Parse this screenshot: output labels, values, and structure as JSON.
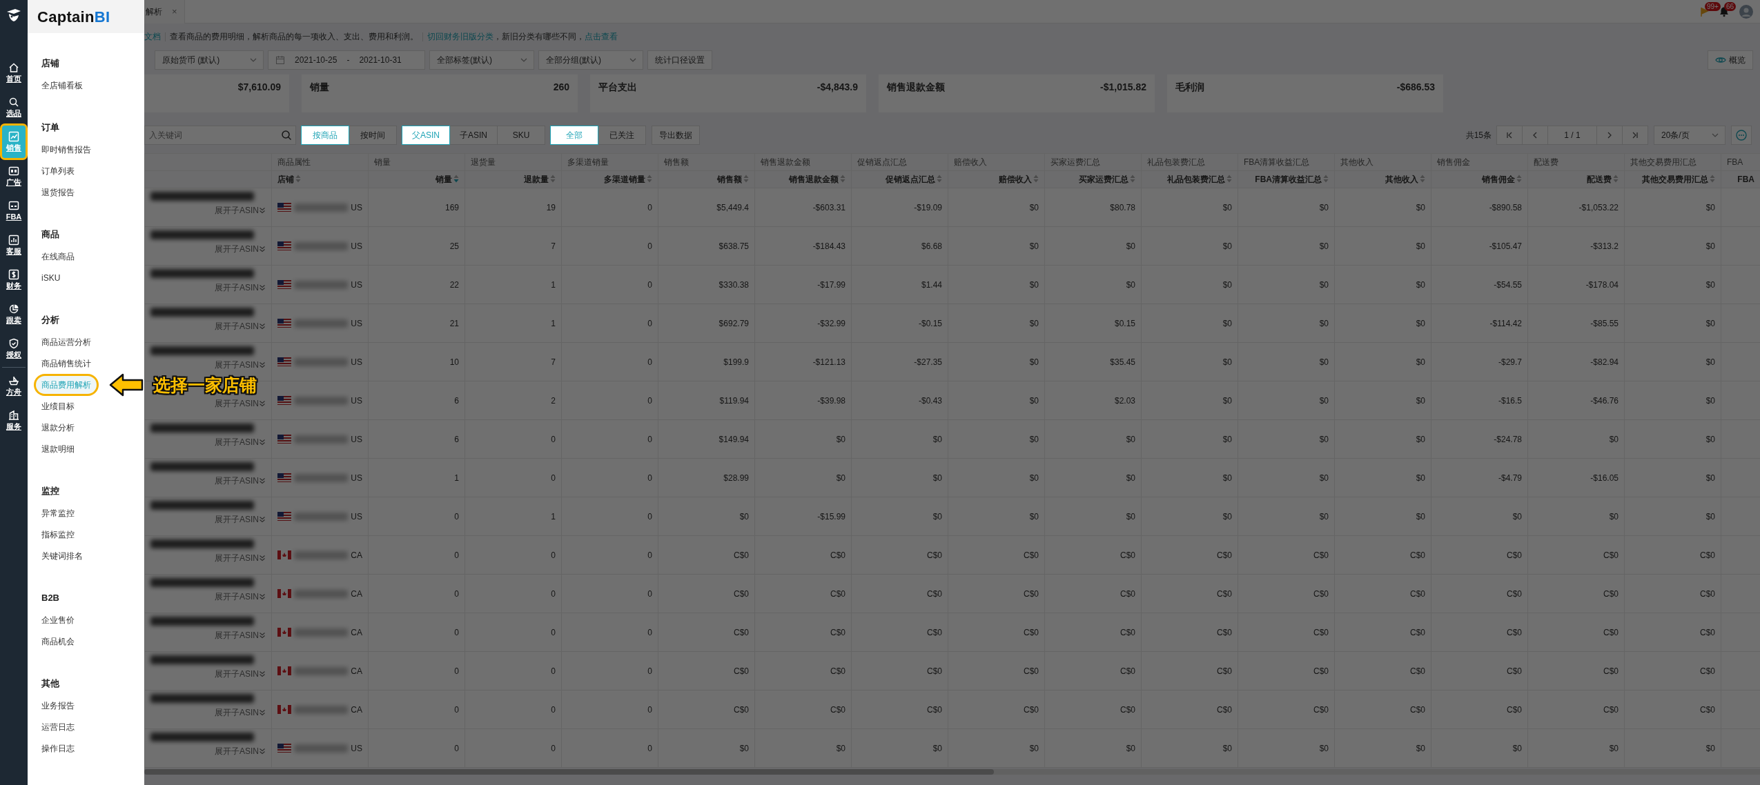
{
  "rail": {
    "items": [
      {
        "label": "首页",
        "selected": false,
        "highlighted": false
      },
      {
        "label": "选品",
        "selected": false,
        "highlighted": false
      },
      {
        "label": "销售",
        "selected": true,
        "highlighted": true
      },
      {
        "label": "广告",
        "selected": false,
        "highlighted": false
      },
      {
        "label": "FBA",
        "selected": false,
        "highlighted": false
      },
      {
        "label": "客服",
        "selected": false,
        "highlighted": false
      },
      {
        "label": "财务",
        "selected": false,
        "highlighted": false
      },
      {
        "label": "跟卖",
        "selected": false,
        "highlighted": false
      },
      {
        "label": "授权",
        "selected": false,
        "highlighted": false
      },
      {
        "label": "方舟",
        "selected": false,
        "highlighted": false
      },
      {
        "label": "服务",
        "selected": false,
        "highlighted": false
      }
    ]
  },
  "menu": {
    "logo": {
      "first": "Captain",
      "second": "BI"
    },
    "sections": [
      {
        "title": "店铺",
        "items": [
          {
            "label": "全店铺看板",
            "selected": false,
            "highlighted": false
          }
        ]
      },
      {
        "title": "订单",
        "items": [
          {
            "label": "即时销售报告",
            "selected": false,
            "highlighted": false
          },
          {
            "label": "订单列表",
            "selected": false,
            "highlighted": false
          },
          {
            "label": "退货报告",
            "selected": false,
            "highlighted": false
          }
        ]
      },
      {
        "title": "商品",
        "items": [
          {
            "label": "在线商品",
            "selected": false,
            "highlighted": false
          },
          {
            "label": "iSKU",
            "selected": false,
            "highlighted": false
          }
        ]
      },
      {
        "title": "分析",
        "items": [
          {
            "label": "商品运营分析",
            "selected": false,
            "highlighted": false
          },
          {
            "label": "商品销售统计",
            "selected": false,
            "highlighted": false
          },
          {
            "label": "商品费用解析",
            "selected": true,
            "highlighted": true
          },
          {
            "label": "业绩目标",
            "selected": false,
            "highlighted": false
          },
          {
            "label": "退款分析",
            "selected": false,
            "highlighted": false
          },
          {
            "label": "退款明细",
            "selected": false,
            "highlighted": false
          }
        ]
      },
      {
        "title": "监控",
        "items": [
          {
            "label": "异常监控",
            "selected": false,
            "highlighted": false
          },
          {
            "label": "指标监控",
            "selected": false,
            "highlighted": false
          },
          {
            "label": "关键词排名",
            "selected": false,
            "highlighted": false
          }
        ]
      },
      {
        "title": "B2B",
        "items": [
          {
            "label": "企业售价",
            "selected": false,
            "highlighted": false
          },
          {
            "label": "商品机会",
            "selected": false,
            "highlighted": false
          }
        ]
      },
      {
        "title": "其他",
        "items": [
          {
            "label": "业务报告",
            "selected": false,
            "highlighted": false
          },
          {
            "label": "运营日志",
            "selected": false,
            "highlighted": false
          },
          {
            "label": "操作日志",
            "selected": false,
            "highlighted": false
          }
        ]
      }
    ]
  },
  "callout": {
    "text": "选择一家店铺"
  },
  "tab": {
    "title": "解析",
    "close": "×"
  },
  "header_badges": [
    "99+",
    "66"
  ],
  "intro": {
    "doc_link": "文档",
    "description": "查看商品的费用明细，解析商品的每一项收入、支出、费用和利润。",
    "old_link": "切回财务旧版分类",
    "middle": "，新旧分类有哪些不同，",
    "action": "点击查看"
  },
  "filters": {
    "currency": "原始货币 (默认)",
    "date_start": "2021-10-25",
    "date_sep": "-",
    "date_end": "2021-10-31",
    "tags": "全部标签(默认)",
    "groups": "全部分组(默认)",
    "settings_button": "统计口径设置",
    "overview_button": "概览"
  },
  "summary": [
    {
      "value": "$7,610.09"
    },
    {
      "label": "销量",
      "value": "260"
    },
    {
      "label": "平台支出",
      "value": "-$4,843.9"
    },
    {
      "label": "销售退款金额",
      "value": "-$1,015.82"
    },
    {
      "label": "毛利润",
      "value": "-$686.53"
    }
  ],
  "toolbar": {
    "search_placeholder": "入关键词",
    "groups": [
      [
        {
          "label": "按商品",
          "selected": true
        },
        {
          "label": "按时间",
          "selected": false
        }
      ],
      [
        {
          "label": "父ASIN",
          "selected": true
        },
        {
          "label": "子ASIN",
          "selected": false
        },
        {
          "label": "SKU",
          "selected": false
        }
      ],
      [
        {
          "label": "全部",
          "selected": true
        },
        {
          "label": "已关注",
          "selected": false
        }
      ]
    ],
    "export": "导出数据",
    "total": "共15条",
    "page_indicator": "1 / 1",
    "page_size": "20条/页"
  },
  "table": {
    "columns": [
      {
        "group": "商品属性",
        "label": "店铺",
        "sorted_desc": false
      },
      {
        "group": "销量",
        "label": "销量",
        "sorted_desc": true
      },
      {
        "group": "退货量",
        "label": "退款量",
        "sorted_desc": false
      },
      {
        "group": "多渠道销量",
        "label": "多渠道销量",
        "sorted_desc": false
      },
      {
        "group": "销售额",
        "label": "销售额",
        "sorted_desc": false
      },
      {
        "group": "销售退款金额",
        "label": "销售退款金额",
        "sorted_desc": false
      },
      {
        "group": "促销返点汇总",
        "label": "促销返点汇总",
        "sorted_desc": false
      },
      {
        "group": "赔偿收入",
        "label": "赔偿收入",
        "sorted_desc": false
      },
      {
        "group": "买家运费汇总",
        "label": "买家运费汇总",
        "sorted_desc": false
      },
      {
        "group": "礼品包装费汇总",
        "label": "礼品包装费汇总",
        "sorted_desc": false
      },
      {
        "group": "FBA清算收益汇总",
        "label": "FBA清算收益汇总",
        "sorted_desc": false
      },
      {
        "group": "其他收入",
        "label": "其他收入",
        "sorted_desc": false
      },
      {
        "group": "销售佣金",
        "label": "销售佣金",
        "sorted_desc": false
      },
      {
        "group": "配送费",
        "label": "配送费",
        "sorted_desc": false
      },
      {
        "group": "其他交易费用汇总",
        "label": "其他交易费用汇总",
        "sorted_desc": false
      },
      {
        "group": "FBA",
        "label": "FBA"
      }
    ],
    "rows": [
      {
        "expand": "展开子ASIN",
        "kind": "us",
        "country": "US",
        "values": [
          "169",
          "19",
          "0",
          "$5,449.4",
          "-$603.31",
          "-$19.09",
          "$0",
          "$80.78",
          "$0",
          "$0",
          "$0",
          "-$890.58",
          "-$1,053.22",
          "$0"
        ]
      },
      {
        "expand": "展开子ASIN",
        "kind": "us",
        "country": "US",
        "values": [
          "25",
          "7",
          "0",
          "$638.75",
          "-$184.43",
          "$6.68",
          "$0",
          "$0",
          "$0",
          "$0",
          "$0",
          "-$105.47",
          "-$313.2",
          "$0"
        ]
      },
      {
        "expand": "展开子ASIN",
        "kind": "us",
        "country": "US",
        "values": [
          "22",
          "1",
          "0",
          "$330.38",
          "-$17.99",
          "$1.44",
          "$0",
          "$0",
          "$0",
          "$0",
          "$0",
          "-$54.55",
          "-$178.04",
          "$0"
        ]
      },
      {
        "expand": "展开子ASIN",
        "kind": "us",
        "country": "US",
        "values": [
          "21",
          "1",
          "0",
          "$692.79",
          "-$32.99",
          "-$0.15",
          "$0",
          "$0.15",
          "$0",
          "$0",
          "$0",
          "-$114.42",
          "-$85.55",
          "$0"
        ]
      },
      {
        "expand": "展开子ASIN",
        "kind": "us",
        "country": "US",
        "values": [
          "10",
          "7",
          "0",
          "$199.9",
          "-$121.13",
          "-$27.35",
          "$0",
          "$35.45",
          "$0",
          "$0",
          "$0",
          "-$29.7",
          "-$82.94",
          "$0"
        ]
      },
      {
        "expand": "展开子ASIN",
        "kind": "us",
        "country": "US",
        "values": [
          "6",
          "2",
          "0",
          "$119.94",
          "-$39.98",
          "-$0.43",
          "$0",
          "$2.03",
          "$0",
          "$0",
          "$0",
          "-$16.5",
          "-$46.76",
          "$0"
        ]
      },
      {
        "expand": "展开子ASIN",
        "kind": "us",
        "country": "US",
        "values": [
          "6",
          "0",
          "0",
          "$149.94",
          "$0",
          "$0",
          "$0",
          "$0",
          "$0",
          "$0",
          "$0",
          "-$24.78",
          "$0",
          "$0"
        ]
      },
      {
        "expand": "展开子ASIN",
        "kind": "us",
        "country": "US",
        "values": [
          "1",
          "0",
          "0",
          "$28.99",
          "$0",
          "$0",
          "$0",
          "$0",
          "$0",
          "$0",
          "$0",
          "-$4.79",
          "-$16.05",
          "$0"
        ]
      },
      {
        "expand": "展开子ASIN",
        "kind": "us",
        "country": "US",
        "values": [
          "0",
          "1",
          "0",
          "$0",
          "-$15.99",
          "$0",
          "$0",
          "$0",
          "$0",
          "$0",
          "$0",
          "$0",
          "$0",
          "$0"
        ]
      },
      {
        "expand": "展开子ASIN",
        "kind": "ca",
        "country": "CA",
        "values": [
          "0",
          "0",
          "0",
          "C$0",
          "C$0",
          "C$0",
          "C$0",
          "C$0",
          "C$0",
          "C$0",
          "C$0",
          "C$0",
          "C$0",
          "C$0"
        ]
      },
      {
        "expand": "展开子ASIN",
        "kind": "ca",
        "country": "CA",
        "values": [
          "0",
          "0",
          "0",
          "C$0",
          "C$0",
          "C$0",
          "C$0",
          "C$0",
          "C$0",
          "C$0",
          "C$0",
          "C$0",
          "C$0",
          "C$0"
        ]
      },
      {
        "expand": "展开子ASIN",
        "kind": "ca",
        "country": "CA",
        "values": [
          "0",
          "0",
          "0",
          "C$0",
          "C$0",
          "C$0",
          "C$0",
          "C$0",
          "C$0",
          "C$0",
          "C$0",
          "C$0",
          "C$0",
          "C$0"
        ]
      },
      {
        "expand": "展开子ASIN",
        "kind": "ca",
        "country": "CA",
        "values": [
          "0",
          "0",
          "0",
          "C$0",
          "C$0",
          "C$0",
          "C$0",
          "C$0",
          "C$0",
          "C$0",
          "C$0",
          "C$0",
          "C$0",
          "C$0"
        ]
      },
      {
        "expand": "展开子ASIN",
        "kind": "ca",
        "country": "CA",
        "values": [
          "0",
          "0",
          "0",
          "C$0",
          "C$0",
          "C$0",
          "C$0",
          "C$0",
          "C$0",
          "C$0",
          "C$0",
          "C$0",
          "C$0",
          "C$0"
        ]
      },
      {
        "expand": "展开子ASIN",
        "kind": "us",
        "country": "US",
        "values": [
          "0",
          "0",
          "0",
          "$0",
          "$0",
          "$0",
          "$0",
          "$0",
          "$0",
          "$0",
          "$0",
          "$0",
          "$0",
          "$0"
        ]
      }
    ]
  }
}
